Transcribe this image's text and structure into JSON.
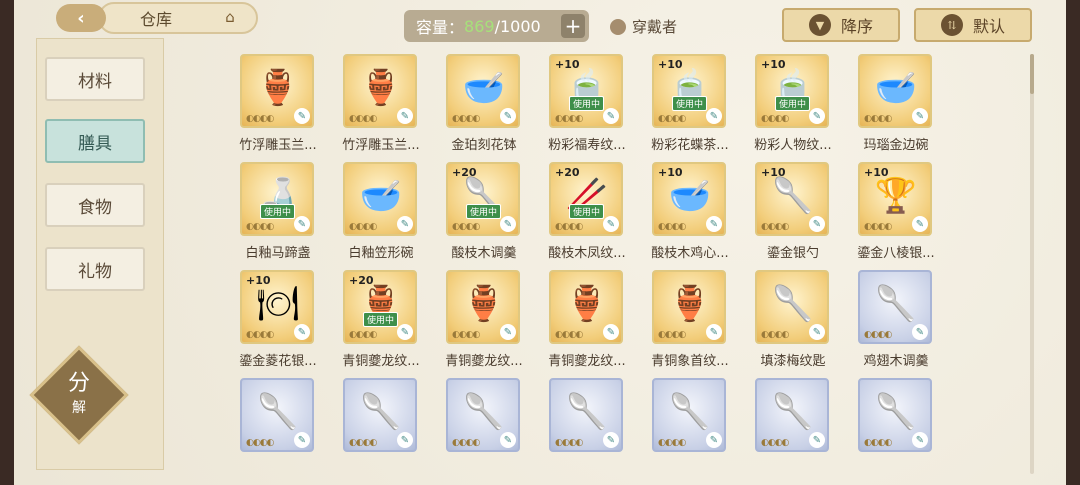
{
  "header": {
    "title": "仓库",
    "capacity_label": "容量：",
    "capacity_current": "869",
    "capacity_max": "/1000",
    "plus": "+",
    "wearer_label": "穿戴者",
    "sort_desc_label": "降序",
    "sort_default_label": "默认"
  },
  "sidebar": {
    "items": [
      {
        "label": "材料"
      },
      {
        "label": "膳具"
      },
      {
        "label": "食物"
      },
      {
        "label": "礼物"
      }
    ],
    "decompose_main": "分",
    "decompose_sub": "解"
  },
  "badges": {
    "in_use": "使用中"
  },
  "items": [
    {
      "name": "竹浮雕玉兰...",
      "plus": "",
      "in_use": false,
      "rarity": "gold",
      "art": "🏺"
    },
    {
      "name": "竹浮雕玉兰...",
      "plus": "",
      "in_use": false,
      "rarity": "gold",
      "art": "🏺"
    },
    {
      "name": "金珀刻花钵",
      "plus": "",
      "in_use": false,
      "rarity": "gold",
      "art": "🥣"
    },
    {
      "name": "粉彩福寿纹...",
      "plus": "+10",
      "in_use": true,
      "rarity": "gold",
      "art": "🍵"
    },
    {
      "name": "粉彩花蝶茶...",
      "plus": "+10",
      "in_use": true,
      "rarity": "gold",
      "art": "🍵"
    },
    {
      "name": "粉彩人物纹...",
      "plus": "+10",
      "in_use": true,
      "rarity": "gold",
      "art": "🍵"
    },
    {
      "name": "玛瑙金边碗",
      "plus": "",
      "in_use": false,
      "rarity": "gold",
      "art": "🥣"
    },
    {
      "name": "白釉马蹄盏",
      "plus": "",
      "in_use": true,
      "rarity": "gold",
      "art": "🍶"
    },
    {
      "name": "白釉笠形碗",
      "plus": "",
      "in_use": false,
      "rarity": "gold",
      "art": "🥣"
    },
    {
      "name": "酸枝木调羹",
      "plus": "+20",
      "in_use": true,
      "rarity": "gold",
      "art": "🥄"
    },
    {
      "name": "酸枝木凤纹...",
      "plus": "+20",
      "in_use": true,
      "rarity": "gold",
      "art": "🥢"
    },
    {
      "name": "酸枝木鸡心...",
      "plus": "+10",
      "in_use": false,
      "rarity": "gold",
      "art": "🥣"
    },
    {
      "name": "鎏金银勺",
      "plus": "+10",
      "in_use": false,
      "rarity": "gold",
      "art": "🥄"
    },
    {
      "name": "鎏金八棱银...",
      "plus": "+10",
      "in_use": false,
      "rarity": "gold",
      "art": "🏆"
    },
    {
      "name": "鎏金菱花银...",
      "plus": "+10",
      "in_use": false,
      "rarity": "gold",
      "art": "🍽"
    },
    {
      "name": "青铜夔龙纹...",
      "plus": "+20",
      "in_use": true,
      "rarity": "gold",
      "art": "🏺"
    },
    {
      "name": "青铜夔龙纹...",
      "plus": "",
      "in_use": false,
      "rarity": "gold",
      "art": "🏺"
    },
    {
      "name": "青铜夔龙纹...",
      "plus": "",
      "in_use": false,
      "rarity": "gold",
      "art": "🏺"
    },
    {
      "name": "青铜象首纹...",
      "plus": "",
      "in_use": false,
      "rarity": "gold",
      "art": "🏺"
    },
    {
      "name": "填漆梅纹匙",
      "plus": "",
      "in_use": false,
      "rarity": "gold",
      "art": "🥄"
    },
    {
      "name": "鸡翅木调羹",
      "plus": "",
      "in_use": false,
      "rarity": "blue",
      "art": "🥄"
    },
    {
      "name": "",
      "plus": "",
      "in_use": false,
      "rarity": "blue",
      "art": "🥄"
    },
    {
      "name": "",
      "plus": "",
      "in_use": false,
      "rarity": "blue",
      "art": "🥄"
    },
    {
      "name": "",
      "plus": "",
      "in_use": false,
      "rarity": "blue",
      "art": "🥄"
    },
    {
      "name": "",
      "plus": "",
      "in_use": false,
      "rarity": "blue",
      "art": "🥄"
    },
    {
      "name": "",
      "plus": "",
      "in_use": false,
      "rarity": "blue",
      "art": "🥄"
    },
    {
      "name": "",
      "plus": "",
      "in_use": false,
      "rarity": "blue",
      "art": "🥄"
    },
    {
      "name": "",
      "plus": "",
      "in_use": false,
      "rarity": "blue",
      "art": "🥄"
    }
  ],
  "colors": {
    "capacity_current": "#a6e07a",
    "active_tab": "#c8e2dc",
    "accent": "#c9ad7a"
  }
}
